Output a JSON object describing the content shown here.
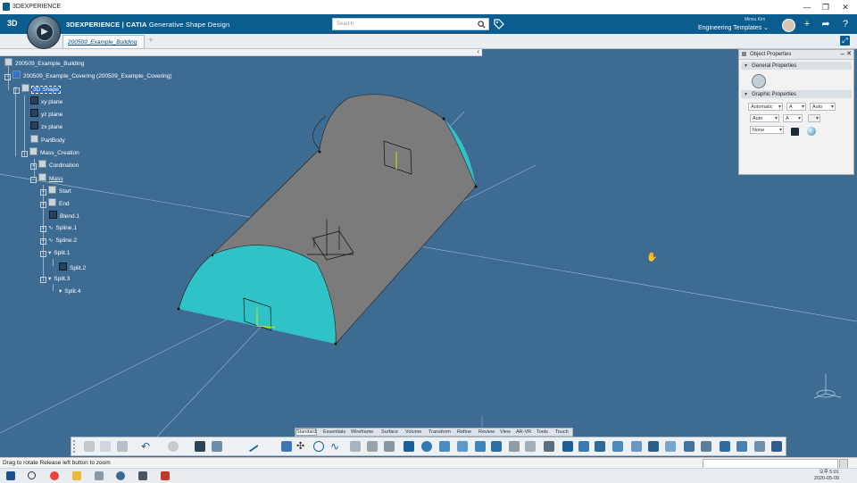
{
  "window": {
    "title": "3DEXPERIENCE",
    "controls": [
      "—",
      "❐",
      "✕"
    ]
  },
  "app": {
    "brand_bold": "3DEXPERIENCE | CATIA",
    "brand_app": "Generative Shape Design",
    "search_placeholder": "Search",
    "user_name": "Minsu Kim",
    "template_label": "Engineering Templates"
  },
  "tabs": [
    {
      "label": "200509_Example_Building"
    }
  ],
  "tree": [
    {
      "label": "200509_Example_Building"
    },
    {
      "label": "200509_Example_Covering (200509_Example_Covering)"
    },
    {
      "label": "3D Shape"
    },
    {
      "label": "xy plane"
    },
    {
      "label": "yz plane"
    },
    {
      "label": "zx plane"
    },
    {
      "label": "PartBody"
    },
    {
      "label": "Mass_Creation"
    },
    {
      "label": "Cordination"
    },
    {
      "label": "Mass"
    },
    {
      "label": "Start"
    },
    {
      "label": "End"
    },
    {
      "label": "Blend.1"
    },
    {
      "label": "Spline.1"
    },
    {
      "label": "Spline.2"
    },
    {
      "label": "Split.1"
    },
    {
      "label": "Split.2"
    },
    {
      "label": "Split.3"
    },
    {
      "label": "Split.4"
    }
  ],
  "properties": {
    "title": "Object Properties",
    "general_section": "General Properties",
    "graphic_section": "Graphic Properties",
    "fields": {
      "color": "Automatic",
      "transparency": "A",
      "linetype": "Auto",
      "thickness": "Auto",
      "point": "A",
      "layer": "None"
    }
  },
  "command_tabs": [
    "Standard",
    "Essentials",
    "Wireframe",
    "Surface",
    "Volume",
    "Transform",
    "Refine",
    "Review",
    "View",
    "AR-VR",
    "Tools",
    "Touch"
  ],
  "active_command_tab": "Essentials",
  "status": {
    "message": "Drag to rotate  Release left button to zoom"
  },
  "taskbar": {
    "time": "오후 5:01",
    "date": "2020-05-09"
  },
  "colors": {
    "viewport": "#3e6b92",
    "appbar": "#0c5d8f",
    "surface_gray": "#7b7b7b",
    "surface_cyan": "#2fc3c7"
  }
}
